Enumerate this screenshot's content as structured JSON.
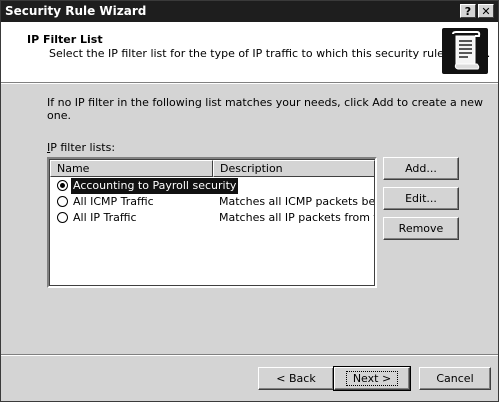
{
  "window": {
    "title": "Security Rule Wizard",
    "help_label": "?",
    "close_label": "✕"
  },
  "header": {
    "title": "IP Filter List",
    "subtitle": "Select the IP filter list for the type of IP traffic to which this security rule applies."
  },
  "intro_text": "If no IP filter in the following list matches your needs, click Add to create a new one.",
  "filter_list": {
    "label": "IP filter lists:",
    "columns": [
      "Name",
      "Description"
    ],
    "rows": [
      {
        "name": "Accounting to Payroll security",
        "description": "",
        "selected": true
      },
      {
        "name": "All ICMP Traffic",
        "description": "Matches all ICMP packets bet...",
        "selected": false
      },
      {
        "name": "All IP Traffic",
        "description": "Matches all IP packets from t...",
        "selected": false
      }
    ]
  },
  "side_buttons": {
    "add": "Add...",
    "edit": "Edit...",
    "remove": "Remove"
  },
  "footer_buttons": {
    "back": "< Back",
    "next": "Next >",
    "cancel": "Cancel"
  },
  "icons": {
    "wizard": "scroll-document-icon"
  }
}
